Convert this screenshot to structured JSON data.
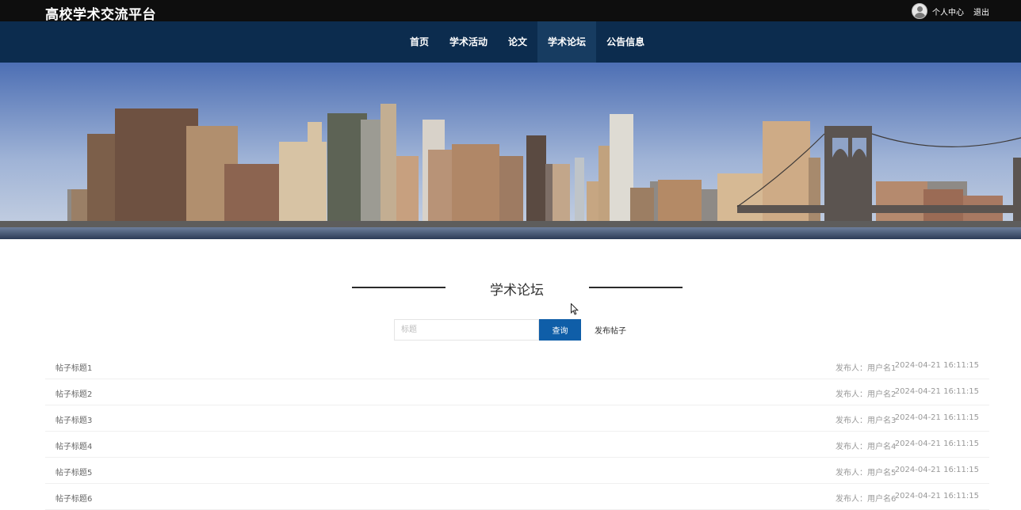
{
  "header": {
    "site_title": "高校学术交流平台",
    "user_center_label": "个人中心",
    "logout_label": "退出"
  },
  "nav": {
    "items": [
      {
        "label": "首页"
      },
      {
        "label": "学术活动"
      },
      {
        "label": "论文"
      },
      {
        "label": "学术论坛"
      },
      {
        "label": "公告信息"
      }
    ],
    "active_index": 3
  },
  "section": {
    "title": "学术论坛"
  },
  "search": {
    "placeholder": "标题",
    "query_label": "查询",
    "post_label": "发布帖子"
  },
  "posts": [
    {
      "title": "帖子标题1",
      "author": "发布人：用户名1",
      "date": "2024-04-21 16:11:15"
    },
    {
      "title": "帖子标题2",
      "author": "发布人：用户名2",
      "date": "2024-04-21 16:11:15"
    },
    {
      "title": "帖子标题3",
      "author": "发布人：用户名3",
      "date": "2024-04-21 16:11:15"
    },
    {
      "title": "帖子标题4",
      "author": "发布人：用户名4",
      "date": "2024-04-21 16:11:15"
    },
    {
      "title": "帖子标题5",
      "author": "发布人：用户名5",
      "date": "2024-04-21 16:11:15"
    },
    {
      "title": "帖子标题6",
      "author": "发布人：用户名6",
      "date": "2024-04-21 16:11:15"
    }
  ],
  "colors": {
    "topbar": "#0e0e0e",
    "nav": "#0c2c4e",
    "nav_active": "#173c61",
    "primary_button": "#0f5ea8"
  }
}
